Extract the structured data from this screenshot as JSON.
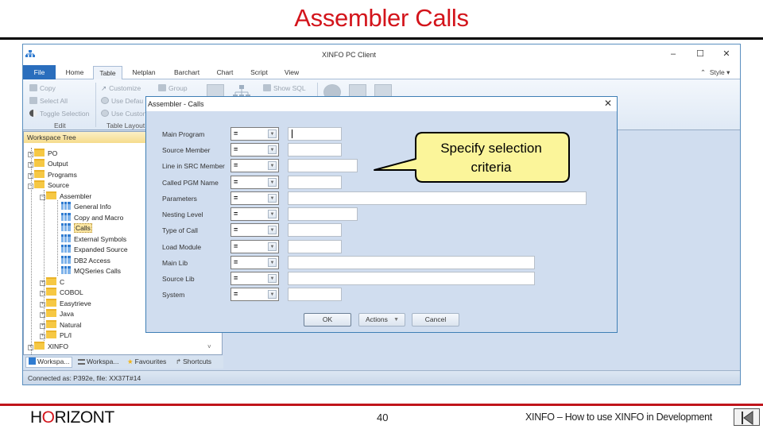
{
  "slide": {
    "title": "Assembler Calls",
    "brand": {
      "pre": "H",
      "o": "O",
      "post": "RIZONT"
    },
    "page_number": "40",
    "footer_text": "XINFO – How to use XINFO in Development",
    "colors": {
      "title": "#d3141b",
      "footer_rule": "#c0141b"
    }
  },
  "app": {
    "window_title": "XINFO PC Client",
    "window_controls": {
      "minimize": "–",
      "maximize": "☐",
      "close": "✕"
    },
    "tabs": [
      {
        "label": "File"
      },
      {
        "label": "Home"
      },
      {
        "label": "Table"
      },
      {
        "label": "Netplan"
      },
      {
        "label": "Barchart"
      },
      {
        "label": "Chart"
      },
      {
        "label": "Script"
      },
      {
        "label": "View"
      }
    ],
    "active_tab": "Table",
    "style_label": "Style",
    "ribbon": {
      "edit": {
        "copy": "Copy",
        "select_all": "Select All",
        "toggle_selection": "Toggle Selection",
        "group_label": "Edit"
      },
      "table_layout": {
        "customize": "Customize",
        "use_default": "Use Defau",
        "use_custom": "Use Custon",
        "group_label": "Table Layout"
      },
      "group": "Group",
      "show_sql": "Show SQL"
    },
    "workspace": {
      "header": "Workspace Tree",
      "tree": [
        {
          "label": "PO",
          "type": "folder",
          "level": 0,
          "expander": "+"
        },
        {
          "label": "Output",
          "type": "folder",
          "level": 0,
          "expander": "+"
        },
        {
          "label": "Programs",
          "type": "folder",
          "level": 0,
          "expander": "+"
        },
        {
          "label": "Source",
          "type": "folder",
          "level": 0,
          "expander": "−"
        },
        {
          "label": "Assembler",
          "type": "folder",
          "level": 1,
          "expander": "−"
        },
        {
          "label": "General Info",
          "type": "table",
          "level": 2
        },
        {
          "label": "Copy and Macro",
          "type": "table",
          "level": 2
        },
        {
          "label": "Calls",
          "type": "table",
          "level": 2,
          "selected": true
        },
        {
          "label": "External Symbols",
          "type": "table",
          "level": 2
        },
        {
          "label": "Expanded Source",
          "type": "table",
          "level": 2
        },
        {
          "label": "DB2 Access",
          "type": "table",
          "level": 2
        },
        {
          "label": "MQSeries Calls",
          "type": "table",
          "level": 2
        },
        {
          "label": "C",
          "type": "folder",
          "level": 1,
          "expander": "+"
        },
        {
          "label": "COBOL",
          "type": "folder",
          "level": 1,
          "expander": "+"
        },
        {
          "label": "Easytrieve",
          "type": "folder",
          "level": 1,
          "expander": "+"
        },
        {
          "label": "Java",
          "type": "folder",
          "level": 1,
          "expander": "+"
        },
        {
          "label": "Natural",
          "type": "folder",
          "level": 1,
          "expander": "+"
        },
        {
          "label": "PL/I",
          "type": "folder",
          "level": 1,
          "expander": "+"
        },
        {
          "label": "XINFO",
          "type": "folder",
          "level": 0,
          "expander": "+"
        }
      ]
    },
    "bottom_tabs": [
      {
        "label": "Workspa..."
      },
      {
        "label": "Workspa..."
      },
      {
        "label": "Favourites"
      },
      {
        "label": "Shortcuts"
      }
    ],
    "status": "Connected as: P392e, file: XX37T#14"
  },
  "dialog": {
    "title": "Assembler - Calls",
    "close": "✕",
    "fields": [
      {
        "label": "Main Program",
        "operator": "=",
        "value": "",
        "width": "s",
        "focused": true
      },
      {
        "label": "Source Member",
        "operator": "=",
        "value": "",
        "width": "s"
      },
      {
        "label": "Line in SRC Member",
        "operator": "=",
        "value": "",
        "width": "m"
      },
      {
        "label": "Called PGM Name",
        "operator": "=",
        "value": "",
        "width": "s"
      },
      {
        "label": "Parameters",
        "operator": "=",
        "value": "",
        "width": "xl"
      },
      {
        "label": "Nesting Level",
        "operator": "=",
        "value": "",
        "width": "m"
      },
      {
        "label": "Type of Call",
        "operator": "=",
        "value": "",
        "width": "s"
      },
      {
        "label": "Load Module",
        "operator": "=",
        "value": "",
        "width": "s"
      },
      {
        "label": "Main Lib",
        "operator": "=",
        "value": "",
        "width": "l"
      },
      {
        "label": "Source Lib",
        "operator": "=",
        "value": "",
        "width": "l"
      },
      {
        "label": "System",
        "operator": "=",
        "value": "",
        "width": "s"
      }
    ],
    "buttons": {
      "ok": "OK",
      "actions": "Actions",
      "cancel": "Cancel"
    }
  },
  "callout": {
    "text_line1": "Specify selection",
    "text_line2": "criteria",
    "fill": "#fbf59a"
  }
}
